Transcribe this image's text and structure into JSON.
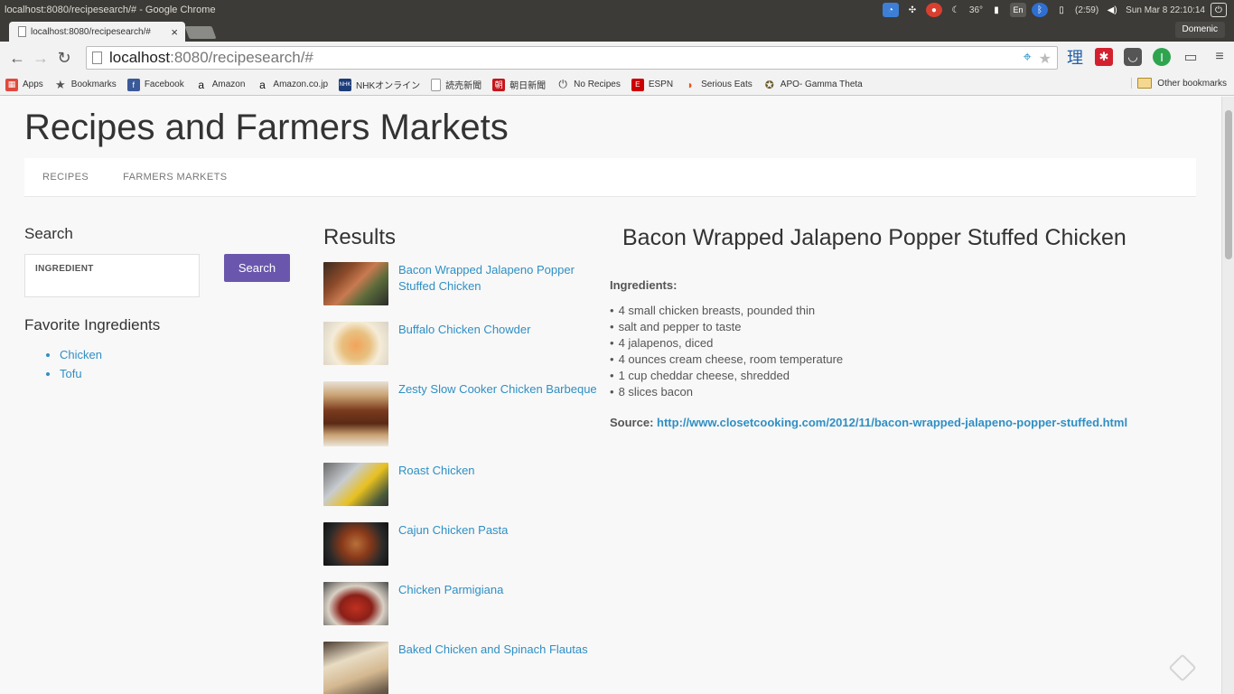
{
  "os": {
    "window_title": "localhost:8080/recipesearch/# - Google Chrome",
    "battery": "(2:59)",
    "temperature": "36°",
    "keyboard": "En",
    "clock": "Sun Mar  8 22:10:14"
  },
  "browser": {
    "tab_title": "localhost:8080/recipesearch/#",
    "profile_name": "Domenic",
    "url_host": "localhost",
    "url_rest": ":8080/recipesearch/#",
    "bookmarks": [
      {
        "label": "Apps",
        "icon": "apps-grid-icon"
      },
      {
        "label": "Bookmarks",
        "icon": "star-icon"
      },
      {
        "label": "Facebook",
        "icon": "facebook-icon"
      },
      {
        "label": "Amazon",
        "icon": "amazon-icon"
      },
      {
        "label": "Amazon.co.jp",
        "icon": "amazon-icon"
      },
      {
        "label": "NHKオンライン",
        "icon": "nhk-icon"
      },
      {
        "label": "読売新聞",
        "icon": "page-icon"
      },
      {
        "label": "朝日新聞",
        "icon": "asahi-icon"
      },
      {
        "label": "No Recipes",
        "icon": "power-icon"
      },
      {
        "label": "ESPN",
        "icon": "espn-icon"
      },
      {
        "label": "Serious Eats",
        "icon": "serious-eats-icon"
      },
      {
        "label": "APO- Gamma Theta",
        "icon": "apo-icon"
      }
    ],
    "other_bookmarks": "Other bookmarks"
  },
  "site": {
    "title": "Recipes and Farmers Markets",
    "nav": [
      "RECIPES",
      "FARMERS MARKETS"
    ]
  },
  "search": {
    "heading": "Search",
    "input_placeholder": "INGREDIENT",
    "button_label": "Search",
    "favorites_heading": "Favorite Ingredients",
    "favorites": [
      "Chicken",
      "Tofu"
    ]
  },
  "results": {
    "heading": "Results",
    "items": [
      "Bacon Wrapped Jalapeno Popper Stuffed Chicken",
      "Buffalo Chicken Chowder",
      "Zesty Slow Cooker Chicken Barbeque",
      "Roast Chicken",
      "Cajun Chicken Pasta",
      "Chicken Parmigiana",
      "Baked Chicken and Spinach Flautas"
    ]
  },
  "detail": {
    "title": "Bacon Wrapped Jalapeno Popper Stuffed Chicken",
    "ingredients_label": "Ingredients:",
    "ingredients": [
      "4 small chicken breasts, pounded thin",
      "salt and pepper to taste",
      "4 jalapenos, diced",
      "4 ounces cream cheese, room temperature",
      "1 cup cheddar cheese, shredded",
      "8 slices bacon"
    ],
    "source_label": "Source:",
    "source_url": "http://www.closetcooking.com/2012/11/bacon-wrapped-jalapeno-popper-stuffed.html"
  },
  "colors": {
    "accent_button": "#6a57ad",
    "link": "#2f8fc4",
    "os_panel": "#3c3b37"
  }
}
